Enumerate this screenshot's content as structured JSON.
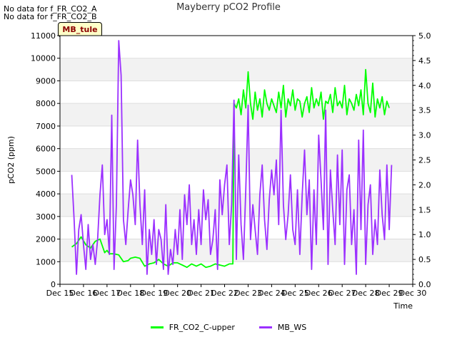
{
  "notices": [
    "No data for f_FR_CO2_A",
    "No data for f_FR_CO2_B"
  ],
  "badge": "MB_tule",
  "chart_data": {
    "type": "line",
    "title": "Mayberry pCO2 Profile",
    "xlabel": "Time",
    "ylabel": "pCO2 (ppm)",
    "y2label": "",
    "xlim": [
      15,
      30
    ],
    "ylim": [
      0,
      11000
    ],
    "y2lim": [
      0,
      5.0
    ],
    "x_ticks": [
      15,
      16,
      17,
      18,
      19,
      20,
      21,
      22,
      23,
      24,
      25,
      26,
      27,
      28,
      29,
      30
    ],
    "x_tick_labels": [
      "Dec 15",
      "Dec 16",
      "Dec 17",
      "Dec 18",
      "Dec 19",
      "Dec 20",
      "Dec 21",
      "Dec 22",
      "Dec 23",
      "Dec 24",
      "Dec 25",
      "Dec 26",
      "Dec 27",
      "Dec 28",
      "Dec 29",
      "Dec 30"
    ],
    "y_ticks": [
      0,
      1000,
      2000,
      3000,
      4000,
      5000,
      6000,
      7000,
      8000,
      9000,
      10000,
      11000
    ],
    "y2_ticks": [
      "0.0",
      "0.5",
      "1.0",
      "1.5",
      "2.0",
      "2.5",
      "3.0",
      "3.5",
      "4.0",
      "4.5",
      "5.0"
    ],
    "grid": "horizontal bands",
    "legend_position": "bottom",
    "series": [
      {
        "name": "FR_CO2_C-upper",
        "color": "#00ff00",
        "axis": "left",
        "x": [
          15.5,
          15.7,
          15.9,
          16.1,
          16.3,
          16.5,
          16.7,
          16.9,
          17.0,
          17.1,
          17.3,
          17.5,
          17.7,
          17.9,
          18.0,
          18.2,
          18.4,
          18.6,
          18.8,
          19.0,
          19.2,
          19.4,
          19.6,
          19.8,
          20.0,
          20.2,
          20.4,
          20.6,
          20.8,
          21.0,
          21.2,
          21.4,
          21.6,
          21.8,
          22.0,
          22.2,
          22.35,
          22.4,
          22.5,
          22.6,
          22.7,
          22.8,
          22.9,
          23.0,
          23.1,
          23.2,
          23.3,
          23.4,
          23.5,
          23.6,
          23.7,
          23.8,
          23.9,
          24.0,
          24.1,
          24.2,
          24.3,
          24.4,
          24.5,
          24.6,
          24.7,
          24.8,
          24.9,
          25.0,
          25.1,
          25.2,
          25.3,
          25.4,
          25.5,
          25.6,
          25.7,
          25.8,
          25.9,
          26.0,
          26.1,
          26.2,
          26.3,
          26.4,
          26.5,
          26.6,
          26.7,
          26.8,
          26.9,
          27.0,
          27.1,
          27.2,
          27.3,
          27.4,
          27.5,
          27.6,
          27.7,
          27.8,
          27.9,
          28.0,
          28.1,
          28.2,
          28.3,
          28.4,
          28.5,
          28.6,
          28.7,
          28.8,
          28.9,
          29.0
        ],
        "y": [
          1650,
          1800,
          2100,
          1750,
          1600,
          1900,
          2000,
          1400,
          1500,
          1350,
          1350,
          1300,
          1000,
          1050,
          1150,
          1200,
          1150,
          800,
          900,
          950,
          1100,
          900,
          800,
          950,
          950,
          850,
          750,
          900,
          800,
          900,
          750,
          800,
          900,
          850,
          800,
          900,
          900,
          8000,
          7800,
          8200,
          7500,
          8600,
          7800,
          9400,
          8000,
          7300,
          8500,
          7700,
          8200,
          7400,
          8600,
          8000,
          7700,
          8200,
          7900,
          7600,
          8500,
          7800,
          8800,
          7400,
          8200,
          7900,
          8600,
          7700,
          8200,
          8100,
          7400,
          8000,
          8300,
          7600,
          8700,
          7800,
          8200,
          7900,
          8500,
          7300,
          8100,
          8000,
          8400,
          7600,
          8700,
          7900,
          8100,
          7800,
          8800,
          7500,
          8200,
          8000,
          7700,
          8400,
          7900,
          8600,
          7500,
          9500,
          8000,
          7600,
          8900,
          7400,
          8200,
          7800,
          8300,
          7500,
          8100,
          7800
        ]
      },
      {
        "name": "MB_WS",
        "color": "#9b30ff",
        "axis": "right",
        "x": [
          15.5,
          15.6,
          15.7,
          15.8,
          15.9,
          16.0,
          16.1,
          16.2,
          16.3,
          16.4,
          16.5,
          16.6,
          16.7,
          16.8,
          16.9,
          17.0,
          17.1,
          17.2,
          17.3,
          17.4,
          17.5,
          17.6,
          17.7,
          17.8,
          17.9,
          18.0,
          18.1,
          18.2,
          18.3,
          18.4,
          18.5,
          18.6,
          18.7,
          18.8,
          18.9,
          19.0,
          19.1,
          19.2,
          19.3,
          19.4,
          19.5,
          19.6,
          19.7,
          19.8,
          19.9,
          20.0,
          20.1,
          20.2,
          20.3,
          20.4,
          20.5,
          20.6,
          20.7,
          20.8,
          20.9,
          21.0,
          21.1,
          21.2,
          21.3,
          21.4,
          21.5,
          21.6,
          21.7,
          21.8,
          21.9,
          22.0,
          22.1,
          22.2,
          22.3,
          22.4,
          22.5,
          22.6,
          22.7,
          22.8,
          22.9,
          23.0,
          23.1,
          23.2,
          23.3,
          23.4,
          23.5,
          23.6,
          23.7,
          23.8,
          23.9,
          24.0,
          24.1,
          24.2,
          24.3,
          24.4,
          24.5,
          24.6,
          24.7,
          24.8,
          24.9,
          25.0,
          25.1,
          25.2,
          25.3,
          25.4,
          25.5,
          25.6,
          25.7,
          25.8,
          25.9,
          26.0,
          26.1,
          26.2,
          26.3,
          26.4,
          26.5,
          26.6,
          26.7,
          26.8,
          26.9,
          27.0,
          27.1,
          27.2,
          27.3,
          27.4,
          27.5,
          27.6,
          27.7,
          27.8,
          27.9,
          28.0,
          28.1,
          28.2,
          28.3,
          28.4,
          28.5,
          28.6,
          28.7,
          28.8,
          28.9,
          29.0,
          29.1
        ],
        "y": [
          2.2,
          1.3,
          0.2,
          1.1,
          1.4,
          0.8,
          0.3,
          1.2,
          0.5,
          0.8,
          0.4,
          0.9,
          1.8,
          2.4,
          1.0,
          1.3,
          0.6,
          3.4,
          0.3,
          1.6,
          4.9,
          4.2,
          1.3,
          0.8,
          1.5,
          2.1,
          1.8,
          1.2,
          2.9,
          1.6,
          0.8,
          1.9,
          0.2,
          1.1,
          0.6,
          1.3,
          0.4,
          1.1,
          0.9,
          0.3,
          1.6,
          0.2,
          0.7,
          0.4,
          1.1,
          0.6,
          1.5,
          0.5,
          1.8,
          1.2,
          2.0,
          0.8,
          1.3,
          0.6,
          1.5,
          0.8,
          1.9,
          1.3,
          1.7,
          0.6,
          0.9,
          1.5,
          0.3,
          2.1,
          1.4,
          2.0,
          2.4,
          0.8,
          1.6,
          3.7,
          0.5,
          2.6,
          1.2,
          0.5,
          1.9,
          3.6,
          0.9,
          1.6,
          1.1,
          0.6,
          1.8,
          2.4,
          1.3,
          0.7,
          1.7,
          2.3,
          1.8,
          2.5,
          1.2,
          3.5,
          1.6,
          0.9,
          1.4,
          2.2,
          1.1,
          0.8,
          1.9,
          0.6,
          1.8,
          2.7,
          1.4,
          2.1,
          0.3,
          1.9,
          0.8,
          3.0,
          2.1,
          1.1,
          3.5,
          0.4,
          2.3,
          1.5,
          0.8,
          2.6,
          1.2,
          2.7,
          0.4,
          1.9,
          2.2,
          0.8,
          1.5,
          0.2,
          2.9,
          1.1,
          3.1,
          0.4,
          1.6,
          2.0,
          0.6,
          1.3,
          0.8,
          2.3,
          1.4,
          0.9,
          2.4,
          1.1,
          2.4
        ]
      }
    ]
  }
}
